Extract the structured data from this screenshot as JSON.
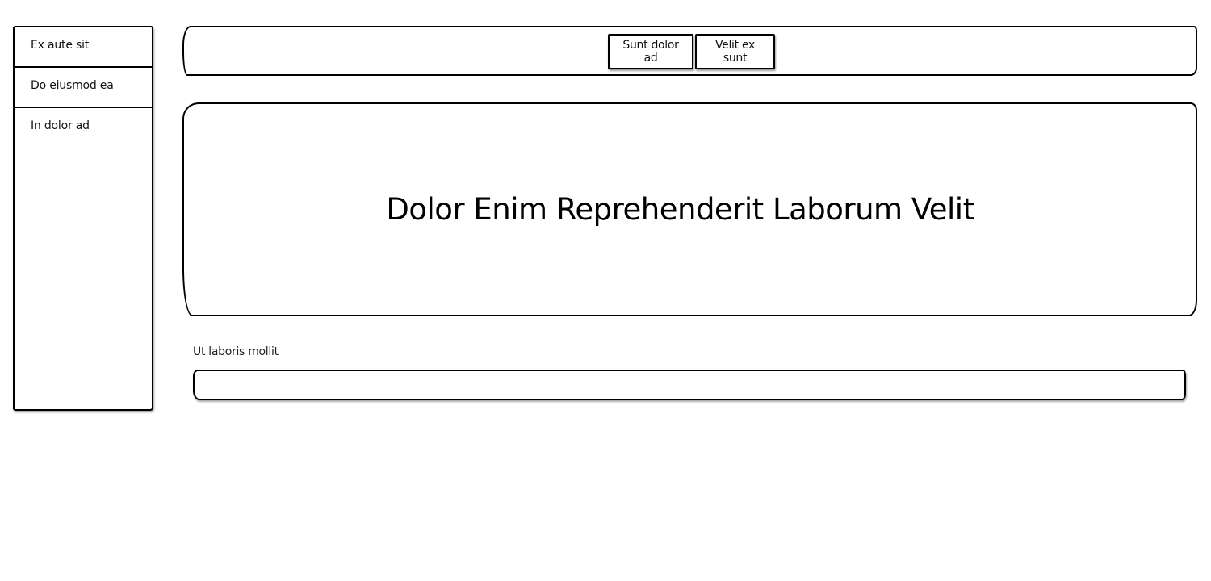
{
  "sidebar": {
    "items": [
      {
        "label": "Ex aute sit"
      },
      {
        "label": "Do eiusmod ea"
      },
      {
        "label": "In dolor ad"
      }
    ]
  },
  "toolbar": {
    "buttons": [
      {
        "label": "Sunt dolor ad"
      },
      {
        "label": "Velit ex sunt"
      }
    ]
  },
  "hero": {
    "title": "Dolor Enim Reprehenderit Laborum Velit"
  },
  "form": {
    "field_label": "Ut laboris mollit",
    "field_value": ""
  }
}
